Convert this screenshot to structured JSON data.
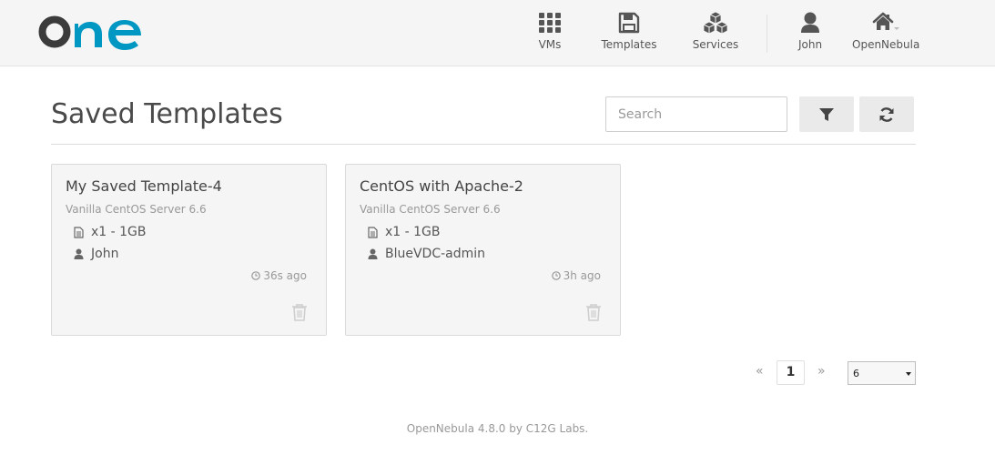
{
  "brand": {
    "logo_text": "one",
    "colors": {
      "dark": "#3b3b3b",
      "accent": "#0098c3"
    }
  },
  "nav": {
    "vms": {
      "label": "VMs",
      "icon": "grid-icon"
    },
    "templates": {
      "label": "Templates",
      "icon": "floppy-disk-icon"
    },
    "services": {
      "label": "Services",
      "icon": "cubes-icon"
    },
    "user": {
      "label": "John",
      "icon": "user-icon"
    },
    "zone": {
      "label": "OpenNebula",
      "icon": "home-icon"
    }
  },
  "header": {
    "title": "Saved Templates",
    "search_placeholder": "Search",
    "filter_icon": "filter-icon",
    "refresh_icon": "refresh-icon"
  },
  "cards": [
    {
      "title": "My Saved Template-4",
      "subtitle": "Vanilla CentOS Server 6.6",
      "capacity": "x1 - 1GB",
      "owner": "John",
      "time": "36s ago"
    },
    {
      "title": "CentOS with Apache-2",
      "subtitle": "Vanilla CentOS Server 6.6",
      "capacity": "x1 - 1GB",
      "owner": "BlueVDC-admin",
      "time": "3h ago"
    }
  ],
  "pagination": {
    "prev": "«",
    "current": "1",
    "next": "»",
    "page_size": "6"
  },
  "footer": {
    "text": "OpenNebula 4.8.0 by C12G Labs."
  }
}
